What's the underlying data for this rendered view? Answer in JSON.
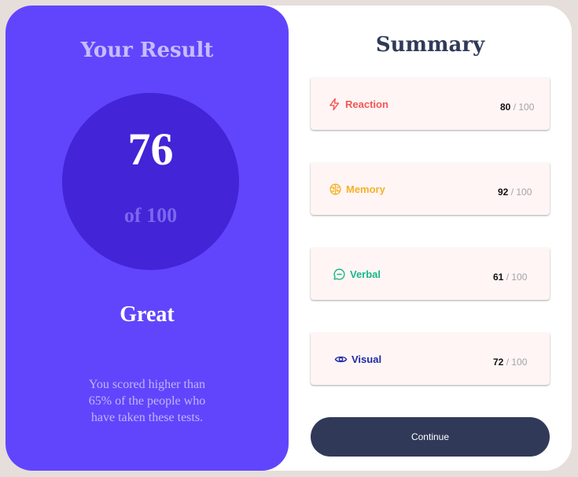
{
  "result": {
    "title": "Your Result",
    "score": "76",
    "total_label": "of 100",
    "rating": "Great",
    "description": "You scored higher than 65% of the people who have taken these tests."
  },
  "summary": {
    "title": "Summary",
    "items": [
      {
        "label": "Reaction",
        "score": "80",
        "total": " / 100",
        "icon": "lightning-icon",
        "color": "#f55555"
      },
      {
        "label": "Memory",
        "score": "92",
        "total": " / 100",
        "icon": "brain-icon",
        "color": "#f5b22a"
      },
      {
        "label": "Verbal",
        "score": "61",
        "total": " / 100",
        "icon": "chat-icon",
        "color": "#17b88b"
      },
      {
        "label": "Visual",
        "score": "72",
        "total": " / 100",
        "icon": "eye-icon",
        "color": "#1d2aa8"
      }
    ]
  },
  "actions": {
    "continue_label": "Continue"
  },
  "colors": {
    "accent": "#6145fc",
    "circle": "#4324d6",
    "button": "#303a58",
    "background": "#e6dedb"
  }
}
